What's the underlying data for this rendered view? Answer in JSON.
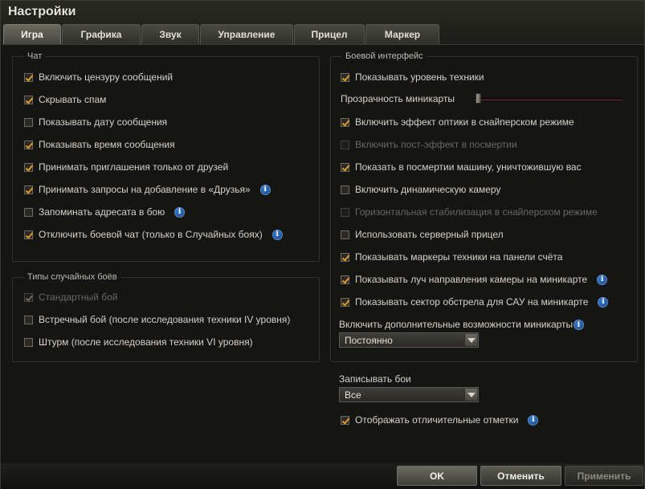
{
  "window": {
    "title": "Настройки"
  },
  "tabs": [
    {
      "label": "Игра"
    },
    {
      "label": "Графика"
    },
    {
      "label": "Звук"
    },
    {
      "label": "Управление"
    },
    {
      "label": "Прицел"
    },
    {
      "label": "Маркер"
    }
  ],
  "chat": {
    "legend": "Чат",
    "items": [
      {
        "label": "Включить цензуру сообщений",
        "checked": true
      },
      {
        "label": "Скрывать спам",
        "checked": true
      },
      {
        "label": "Показывать дату сообщения",
        "checked": false
      },
      {
        "label": "Показывать время сообщения",
        "checked": true
      },
      {
        "label": "Принимать приглашения только от друзей",
        "checked": true
      },
      {
        "label": "Принимать запросы на добавление в «Друзья»",
        "checked": true,
        "info": true
      },
      {
        "label": "Запоминать адресата в бою",
        "checked": false,
        "info": true
      },
      {
        "label": "Отключить боевой чат (только в Случайных боях)",
        "checked": true,
        "info": true
      }
    ]
  },
  "battle_types": {
    "legend": "Типы случайных боёв",
    "items": [
      {
        "label": "Стандартный бой",
        "checked": true,
        "disabled": true
      },
      {
        "label": "Встречный бой (после исследования техники IV уровня)",
        "checked": false
      },
      {
        "label": "Штурм (после исследования техники VI уровня)",
        "checked": false
      }
    ]
  },
  "battle_interface": {
    "legend": "Боевой интерфейс",
    "show_tier": {
      "label": "Показывать уровень техники",
      "checked": true
    },
    "minimap_opacity_label": "Прозрачность миникарты",
    "minimap_opacity_value": 0,
    "items": [
      {
        "label": "Включить эффект оптики в снайперском режиме",
        "checked": true
      },
      {
        "label": "Включить пост-эффект в посмертии",
        "checked": false,
        "disabled": true
      },
      {
        "label": "Показать в посмертии машину, уничтожившую вас",
        "checked": true
      },
      {
        "label": "Включить динамическую камеру",
        "checked": false
      },
      {
        "label": "Горизонтальная стабилизация в снайперском режиме",
        "checked": false,
        "disabled": true
      },
      {
        "label": "Использовать серверный прицел",
        "checked": false
      },
      {
        "label": "Показывать маркеры техники на панели счёта",
        "checked": true
      },
      {
        "label": "Показывать луч направления камеры на миникарте",
        "checked": true,
        "info": true
      },
      {
        "label": "Показывать сектор обстрела для САУ на миникарте",
        "checked": true,
        "info": true
      }
    ],
    "minimap_extra": {
      "label": "Включить дополнительные возможности миникарты",
      "value": "Постоянно"
    }
  },
  "replays": {
    "label": "Записывать бои",
    "value": "Все",
    "marks": {
      "label": "Отображать отличительные отметки",
      "checked": true
    }
  },
  "buttons": {
    "ok": "OK",
    "cancel": "Отменить",
    "apply": "Применить"
  },
  "colors": {
    "accent_check": "#e09a2a",
    "info_icon": "#2f6fc8"
  }
}
